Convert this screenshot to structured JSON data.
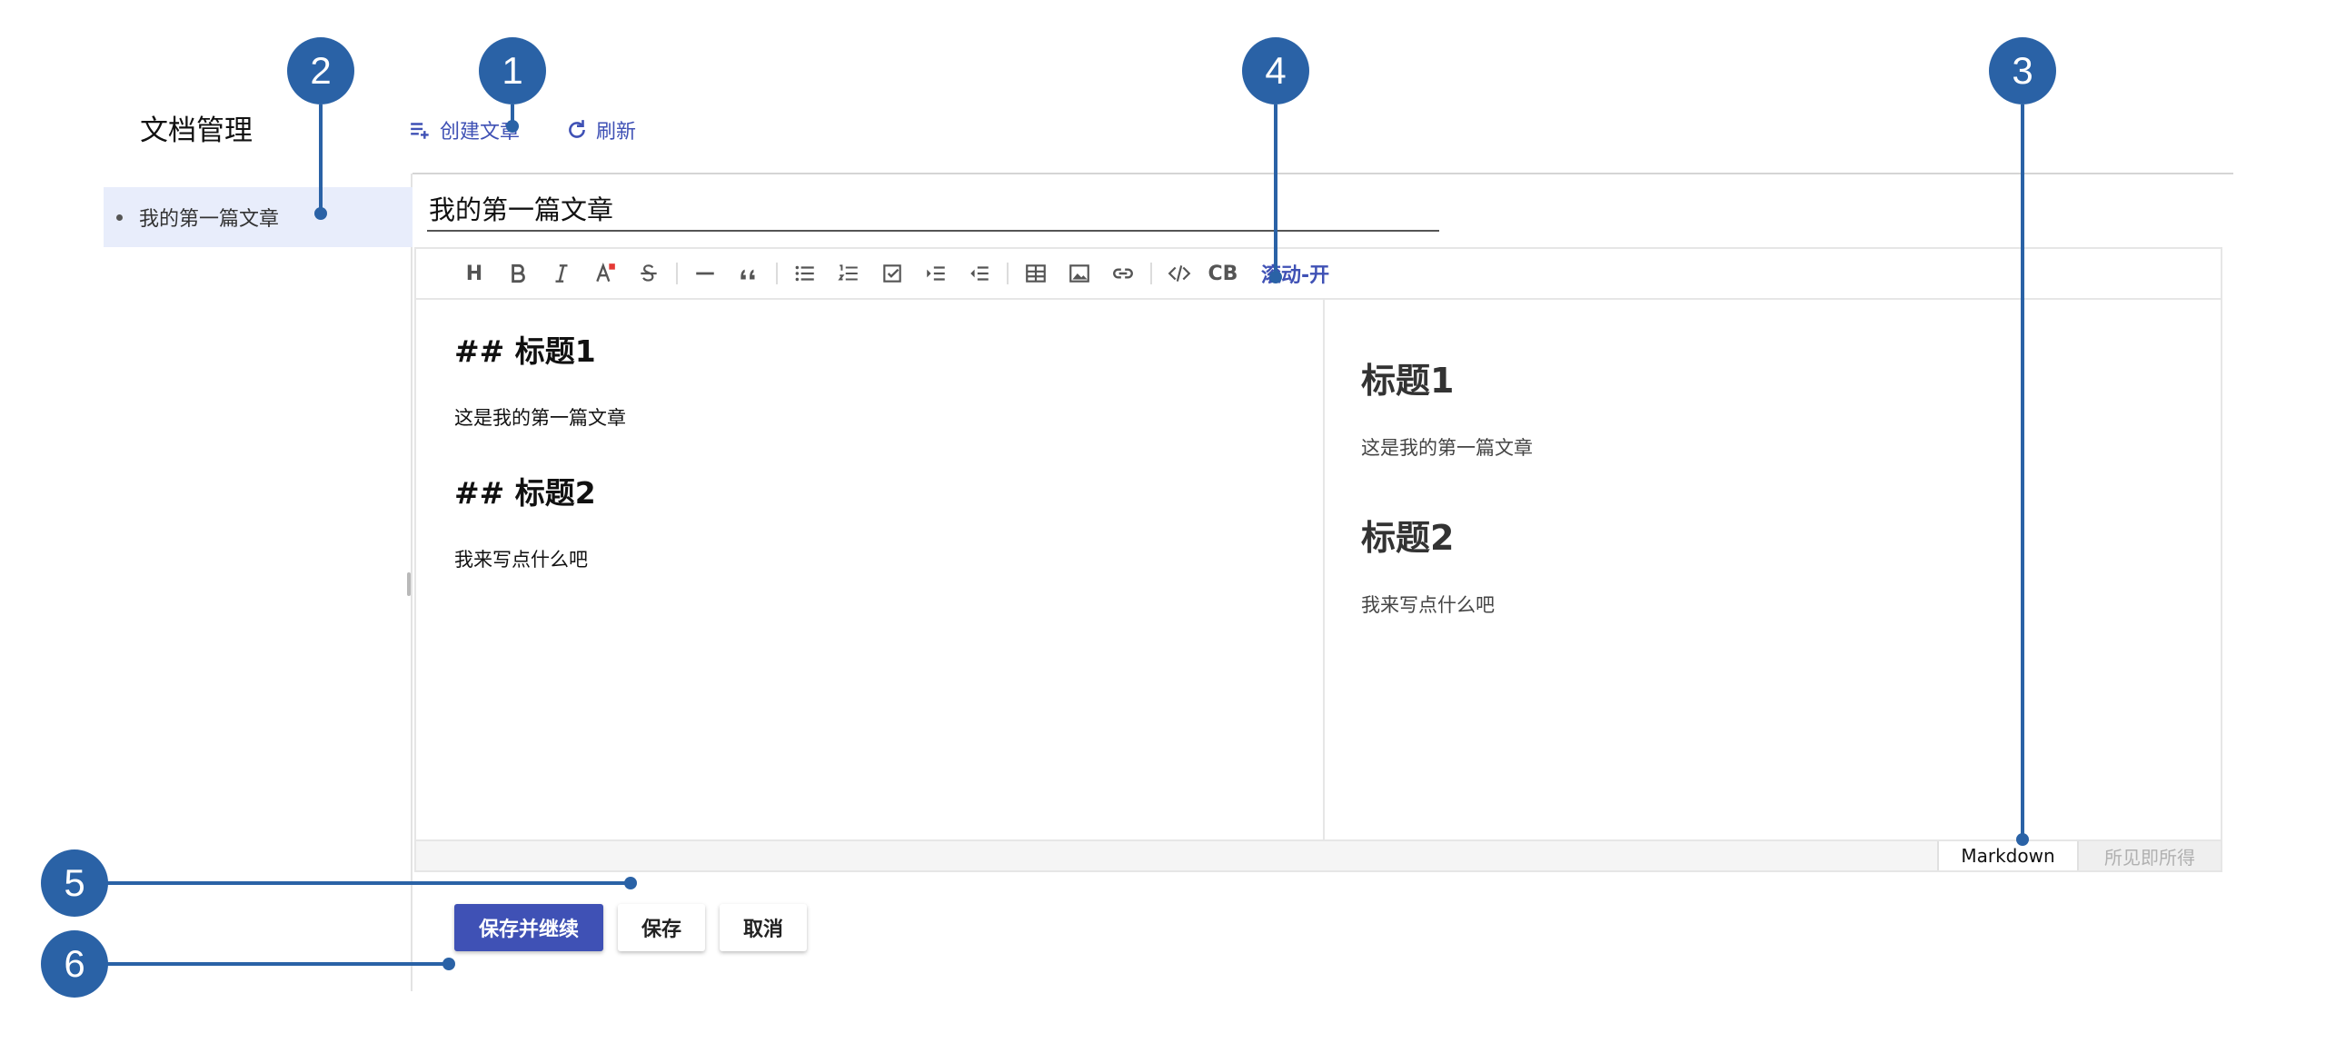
{
  "header": {
    "title": "文档管理",
    "create_label": "创建文章",
    "refresh_label": "刷新"
  },
  "sidebar": {
    "items": [
      {
        "label": "我的第一篇文章"
      }
    ]
  },
  "editor": {
    "title_value": "我的第一篇文章",
    "scroll_toggle": "滚动-开",
    "toolbar_labels": {
      "heading": "H",
      "codeblock": "CB"
    },
    "source": {
      "h1": "## 标题1",
      "p1": "这是我的第一篇文章",
      "h2": "## 标题2",
      "p2": "我来写点什么吧"
    },
    "preview": {
      "h1": "标题1",
      "p1": "这是我的第一篇文章",
      "h2": "标题2",
      "p2": "我来写点什么吧"
    },
    "modes": {
      "markdown": "Markdown",
      "wysiwyg": "所见即所得"
    }
  },
  "actions": {
    "save_continue": "保存并继续",
    "save": "保存",
    "cancel": "取消"
  },
  "callouts": [
    "1",
    "2",
    "3",
    "4",
    "5",
    "6"
  ],
  "colors": {
    "accent": "#3f51b5",
    "callout": "#2a62a6"
  }
}
